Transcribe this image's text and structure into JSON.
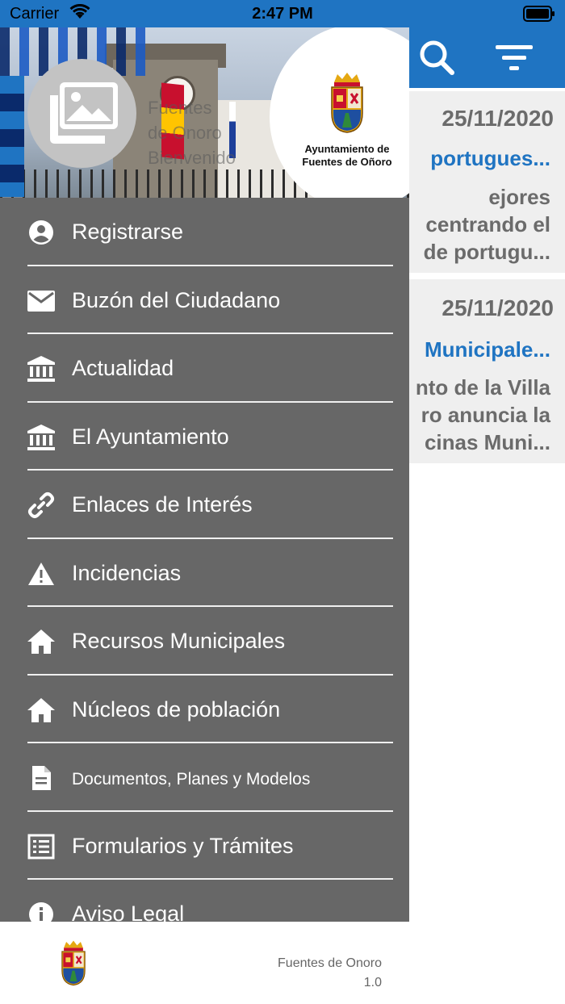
{
  "status_bar": {
    "carrier": "Carrier",
    "time": "2:47 PM"
  },
  "header": {
    "search_icon": "search-icon",
    "filter_icon": "filter-icon"
  },
  "cards": [
    {
      "date": "25/11/2020",
      "title": "portugues...",
      "body": "ejores\ncentrando el\nde portugu..."
    },
    {
      "date": "25/11/2020",
      "title": "Municipale...",
      "body": "nto de la Villa\nro anuncia la\ncinas Muni..."
    }
  ],
  "drawer": {
    "hero_text": "Fuentes\nde Onoro\nBienvenido",
    "crest_caption_1": "Ayuntamiento de",
    "crest_caption_2": "Fuentes de Oñoro",
    "menu": [
      {
        "label": "Registrarse",
        "icon": "account-icon"
      },
      {
        "label": "Buzón del Ciudadano",
        "icon": "mail-icon"
      },
      {
        "label": "Actualidad",
        "icon": "institution-icon"
      },
      {
        "label": "El Ayuntamiento",
        "icon": "institution-icon"
      },
      {
        "label": "Enlaces de Interés",
        "icon": "link-icon"
      },
      {
        "label": "Incidencias",
        "icon": "warning-icon"
      },
      {
        "label": "Recursos Municipales",
        "icon": "home-icon"
      },
      {
        "label": "Núcleos de población",
        "icon": "home-icon"
      },
      {
        "label": "Documentos, Planes y Modelos",
        "icon": "document-icon"
      },
      {
        "label": "Formularios y Trámites",
        "icon": "form-list-icon"
      },
      {
        "label": "Aviso Legal",
        "icon": "info-icon"
      }
    ]
  },
  "footer": {
    "app_name": "Fuentes de Onoro",
    "version": "1.0"
  },
  "colors": {
    "accent": "#1f74c2",
    "drawer_bg": "#676767",
    "card_bg": "#efefef",
    "muted_text": "#6b6b6b"
  }
}
